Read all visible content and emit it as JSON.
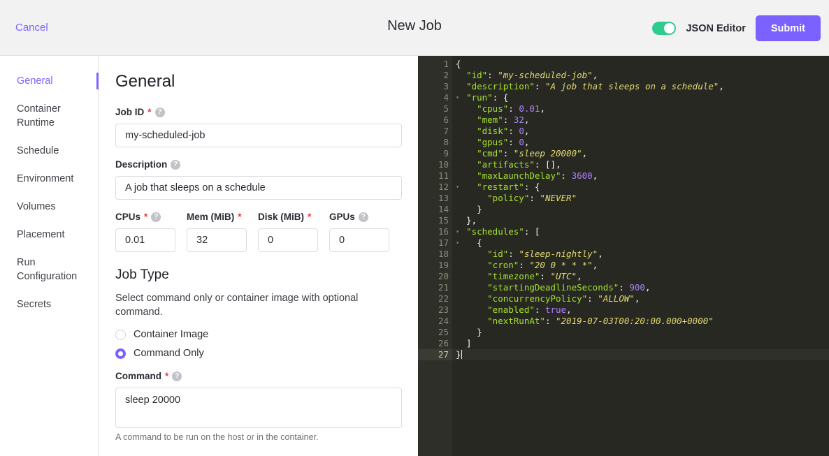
{
  "header": {
    "cancel_label": "Cancel",
    "title": "New Job",
    "json_editor_label": "JSON Editor",
    "json_editor_enabled": true,
    "submit_label": "Submit",
    "accent_color": "#7b61ff",
    "toggle_on_color": "#2ecc8f"
  },
  "sidebar": {
    "items": [
      {
        "label": "General",
        "active": true
      },
      {
        "label": "Container Runtime",
        "active": false
      },
      {
        "label": "Schedule",
        "active": false
      },
      {
        "label": "Environment",
        "active": false
      },
      {
        "label": "Volumes",
        "active": false
      },
      {
        "label": "Placement",
        "active": false
      },
      {
        "label": "Run Configuration",
        "active": false
      },
      {
        "label": "Secrets",
        "active": false
      }
    ]
  },
  "form": {
    "section_title": "General",
    "job_id": {
      "label": "Job ID",
      "required": true,
      "has_help": true,
      "value": "my-scheduled-job"
    },
    "description": {
      "label": "Description",
      "required": false,
      "has_help": true,
      "value": "A job that sleeps on a schedule"
    },
    "resources": [
      {
        "label": "CPUs",
        "required": true,
        "has_help": true,
        "value": "0.01"
      },
      {
        "label": "Mem (MiB)",
        "required": true,
        "has_help": false,
        "value": "32"
      },
      {
        "label": "Disk (MiB)",
        "required": true,
        "has_help": false,
        "value": "0"
      },
      {
        "label": "GPUs",
        "required": false,
        "has_help": true,
        "value": "0"
      }
    ],
    "job_type": {
      "title": "Job Type",
      "description": "Select command only or container image with optional command.",
      "options": [
        {
          "label": "Container Image",
          "selected": false
        },
        {
          "label": "Command Only",
          "selected": true
        }
      ]
    },
    "command": {
      "label": "Command",
      "required": true,
      "has_help": true,
      "value": "sleep 20000",
      "hint": "A command to be run on the host or in the container."
    },
    "help_icon_glyph": "?"
  },
  "editor": {
    "background": "#272822",
    "active_line": 27,
    "lines": [
      {
        "num": 1,
        "fold": true,
        "tokens": [
          {
            "t": "{",
            "c": "p"
          }
        ]
      },
      {
        "num": 2,
        "fold": false,
        "tokens": [
          {
            "t": "  \"id\"",
            "c": "k"
          },
          {
            "t": ": ",
            "c": "p"
          },
          {
            "t": "\"my-scheduled-job\"",
            "c": "s"
          },
          {
            "t": ",",
            "c": "p"
          }
        ]
      },
      {
        "num": 3,
        "fold": false,
        "tokens": [
          {
            "t": "  \"description\"",
            "c": "k"
          },
          {
            "t": ": ",
            "c": "p"
          },
          {
            "t": "\"A job that sleeps on a schedule\"",
            "c": "s"
          },
          {
            "t": ",",
            "c": "p"
          }
        ]
      },
      {
        "num": 4,
        "fold": true,
        "tokens": [
          {
            "t": "  \"run\"",
            "c": "k"
          },
          {
            "t": ": {",
            "c": "p"
          }
        ]
      },
      {
        "num": 5,
        "fold": false,
        "tokens": [
          {
            "t": "    \"cpus\"",
            "c": "k"
          },
          {
            "t": ": ",
            "c": "p"
          },
          {
            "t": "0.01",
            "c": "n"
          },
          {
            "t": ",",
            "c": "p"
          }
        ]
      },
      {
        "num": 6,
        "fold": false,
        "tokens": [
          {
            "t": "    \"mem\"",
            "c": "k"
          },
          {
            "t": ": ",
            "c": "p"
          },
          {
            "t": "32",
            "c": "n"
          },
          {
            "t": ",",
            "c": "p"
          }
        ]
      },
      {
        "num": 7,
        "fold": false,
        "tokens": [
          {
            "t": "    \"disk\"",
            "c": "k"
          },
          {
            "t": ": ",
            "c": "p"
          },
          {
            "t": "0",
            "c": "n"
          },
          {
            "t": ",",
            "c": "p"
          }
        ]
      },
      {
        "num": 8,
        "fold": false,
        "tokens": [
          {
            "t": "    \"gpus\"",
            "c": "k"
          },
          {
            "t": ": ",
            "c": "p"
          },
          {
            "t": "0",
            "c": "n"
          },
          {
            "t": ",",
            "c": "p"
          }
        ]
      },
      {
        "num": 9,
        "fold": false,
        "tokens": [
          {
            "t": "    \"cmd\"",
            "c": "k"
          },
          {
            "t": ": ",
            "c": "p"
          },
          {
            "t": "\"sleep 20000\"",
            "c": "s"
          },
          {
            "t": ",",
            "c": "p"
          }
        ]
      },
      {
        "num": 10,
        "fold": false,
        "tokens": [
          {
            "t": "    \"artifacts\"",
            "c": "k"
          },
          {
            "t": ": ",
            "c": "p"
          },
          {
            "t": "[]",
            "c": "p"
          },
          {
            "t": ",",
            "c": "p"
          }
        ]
      },
      {
        "num": 11,
        "fold": false,
        "tokens": [
          {
            "t": "    \"maxLaunchDelay\"",
            "c": "k"
          },
          {
            "t": ": ",
            "c": "p"
          },
          {
            "t": "3600",
            "c": "n"
          },
          {
            "t": ",",
            "c": "p"
          }
        ]
      },
      {
        "num": 12,
        "fold": true,
        "tokens": [
          {
            "t": "    \"restart\"",
            "c": "k"
          },
          {
            "t": ": {",
            "c": "p"
          }
        ]
      },
      {
        "num": 13,
        "fold": false,
        "tokens": [
          {
            "t": "      \"policy\"",
            "c": "k"
          },
          {
            "t": ": ",
            "c": "p"
          },
          {
            "t": "\"NEVER\"",
            "c": "s"
          }
        ]
      },
      {
        "num": 14,
        "fold": false,
        "tokens": [
          {
            "t": "    }",
            "c": "p"
          }
        ]
      },
      {
        "num": 15,
        "fold": false,
        "tokens": [
          {
            "t": "  },",
            "c": "p"
          }
        ]
      },
      {
        "num": 16,
        "fold": true,
        "tokens": [
          {
            "t": "  \"schedules\"",
            "c": "k"
          },
          {
            "t": ": [",
            "c": "p"
          }
        ]
      },
      {
        "num": 17,
        "fold": true,
        "tokens": [
          {
            "t": "    {",
            "c": "p"
          }
        ]
      },
      {
        "num": 18,
        "fold": false,
        "tokens": [
          {
            "t": "      \"id\"",
            "c": "k"
          },
          {
            "t": ": ",
            "c": "p"
          },
          {
            "t": "\"sleep-nightly\"",
            "c": "s"
          },
          {
            "t": ",",
            "c": "p"
          }
        ]
      },
      {
        "num": 19,
        "fold": false,
        "tokens": [
          {
            "t": "      \"cron\"",
            "c": "k"
          },
          {
            "t": ": ",
            "c": "p"
          },
          {
            "t": "\"20 0 * * *\"",
            "c": "s"
          },
          {
            "t": ",",
            "c": "p"
          }
        ]
      },
      {
        "num": 20,
        "fold": false,
        "tokens": [
          {
            "t": "      \"timezone\"",
            "c": "k"
          },
          {
            "t": ": ",
            "c": "p"
          },
          {
            "t": "\"UTC\"",
            "c": "s"
          },
          {
            "t": ",",
            "c": "p"
          }
        ]
      },
      {
        "num": 21,
        "fold": false,
        "tokens": [
          {
            "t": "      \"startingDeadlineSeconds\"",
            "c": "k"
          },
          {
            "t": ": ",
            "c": "p"
          },
          {
            "t": "900",
            "c": "n"
          },
          {
            "t": ",",
            "c": "p"
          }
        ]
      },
      {
        "num": 22,
        "fold": false,
        "tokens": [
          {
            "t": "      \"concurrencyPolicy\"",
            "c": "k"
          },
          {
            "t": ": ",
            "c": "p"
          },
          {
            "t": "\"ALLOW\"",
            "c": "s"
          },
          {
            "t": ",",
            "c": "p"
          }
        ]
      },
      {
        "num": 23,
        "fold": false,
        "tokens": [
          {
            "t": "      \"enabled\"",
            "c": "k"
          },
          {
            "t": ": ",
            "c": "p"
          },
          {
            "t": "true",
            "c": "n"
          },
          {
            "t": ",",
            "c": "p"
          }
        ]
      },
      {
        "num": 24,
        "fold": false,
        "tokens": [
          {
            "t": "      \"nextRunAt\"",
            "c": "k"
          },
          {
            "t": ": ",
            "c": "p"
          },
          {
            "t": "\"2019-07-03T00:20:00.000+0000\"",
            "c": "s"
          }
        ]
      },
      {
        "num": 25,
        "fold": false,
        "tokens": [
          {
            "t": "    }",
            "c": "p"
          }
        ]
      },
      {
        "num": 26,
        "fold": false,
        "tokens": [
          {
            "t": "  ]",
            "c": "p"
          }
        ]
      },
      {
        "num": 27,
        "fold": false,
        "tokens": [
          {
            "t": "}",
            "c": "p"
          }
        ]
      }
    ]
  }
}
